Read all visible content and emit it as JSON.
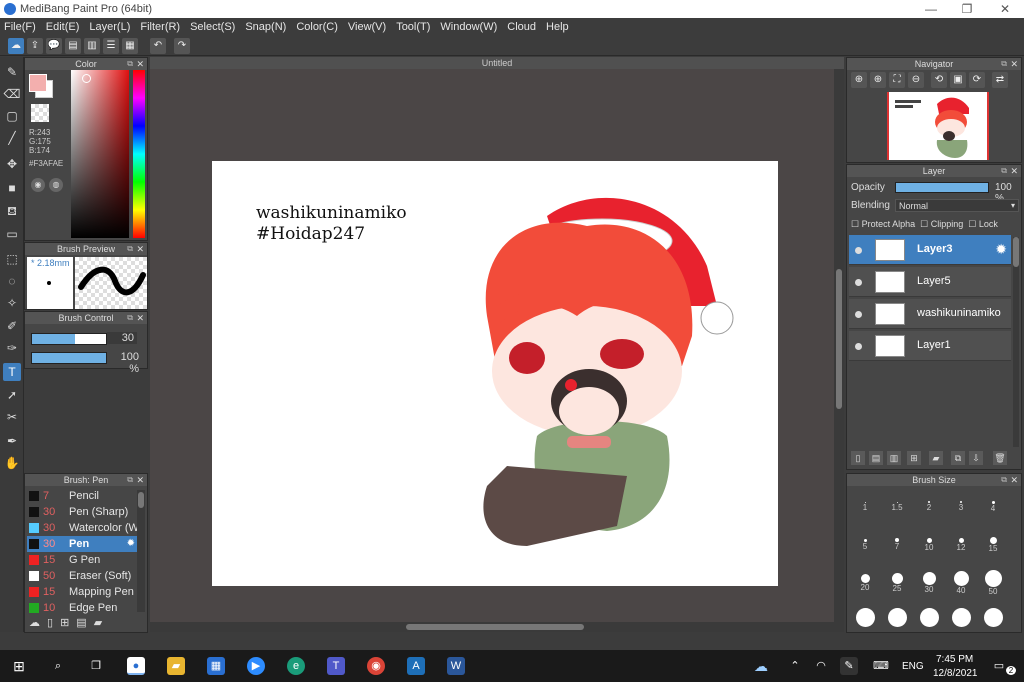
{
  "window": {
    "title": "MediBang Paint Pro (64bit)",
    "minimize": "—",
    "maximize": "❐",
    "close": "✕"
  },
  "menu": [
    "File(F)",
    "Edit(E)",
    "Layer(L)",
    "Filter(R)",
    "Select(S)",
    "Snap(N)",
    "Color(C)",
    "View(V)",
    "Tool(T)",
    "Window(W)",
    "Cloud",
    "Help"
  ],
  "canvas": {
    "tab_title": "Untitled",
    "text_line1": "washikuninamiko",
    "text_line2": "#Hoidap247"
  },
  "color_panel": {
    "title": "Color",
    "r": "R:243",
    "g": "G:175",
    "b": "B:174",
    "hex": "#F3AFAE",
    "fg_color": "#f3afae"
  },
  "brush_preview": {
    "title": "Brush Preview",
    "size": "* 2.18mm"
  },
  "brush_control": {
    "title": "Brush Control",
    "size_value": "30",
    "size_fill": 0.58,
    "opacity_value": "100 %",
    "opacity_fill": 1.0
  },
  "brush_panel": {
    "title": "Brush: Pen",
    "items": [
      {
        "size": "7",
        "name": "Pencil",
        "color": "#111111"
      },
      {
        "size": "30",
        "name": "Pen (Sharp)",
        "color": "#111111"
      },
      {
        "size": "30",
        "name": "Watercolor (W",
        "color": "#55ccff"
      },
      {
        "size": "30",
        "name": "Pen",
        "color": "#111111",
        "active": true
      },
      {
        "size": "15",
        "name": "G Pen",
        "color": "#ee2222"
      },
      {
        "size": "50",
        "name": "Eraser (Soft)",
        "color": "#ffffff"
      },
      {
        "size": "15",
        "name": "Mapping Pen",
        "color": "#ee2222"
      },
      {
        "size": "10",
        "name": "Edge Pen",
        "color": "#22aa22"
      }
    ]
  },
  "navigator": {
    "title": "Navigator"
  },
  "layer_panel": {
    "title": "Layer",
    "opacity_label": "Opacity",
    "opacity_value": "100 %",
    "opacity_fill": 1.0,
    "blending_label": "Blending",
    "blending_value": "Normal",
    "protect_alpha": "Protect Alpha",
    "clipping": "Clipping",
    "lock": "Lock",
    "layers": [
      {
        "name": "Layer3",
        "active": true
      },
      {
        "name": "Layer5"
      },
      {
        "name": "washikuninamiko"
      },
      {
        "name": "Layer1"
      }
    ]
  },
  "brush_size": {
    "title": "Brush Size",
    "sizes": [
      "1",
      "1.5",
      "2",
      "3",
      "4",
      "5",
      "7",
      "10",
      "12",
      "15",
      "20",
      "25",
      "30",
      "40",
      "50"
    ]
  },
  "taskbar": {
    "lang": "ENG",
    "time": "7:45 PM",
    "date": "12/8/2021",
    "notif": "2"
  }
}
